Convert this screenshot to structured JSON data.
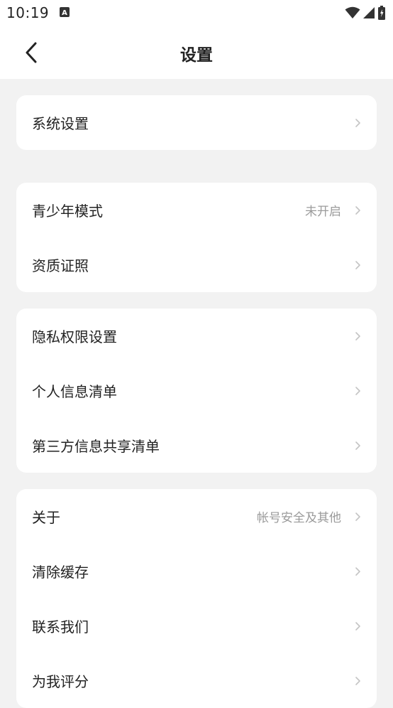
{
  "status_bar": {
    "time": "10:19",
    "app_icon": "A",
    "icons": [
      "wifi-icon",
      "signal-icon",
      "battery-icon"
    ]
  },
  "header": {
    "title": "设置",
    "back_icon": "back-arrow-icon"
  },
  "sections": [
    {
      "items": [
        {
          "label": "系统设置"
        }
      ]
    },
    {
      "items": [
        {
          "label": "青少年模式",
          "value": "未开启"
        },
        {
          "label": "资质证照"
        }
      ]
    },
    {
      "items": [
        {
          "label": "隐私权限设置"
        },
        {
          "label": "个人信息清单"
        },
        {
          "label": "第三方信息共享清单"
        }
      ]
    },
    {
      "items": [
        {
          "label": "关于",
          "value": "帐号安全及其他"
        },
        {
          "label": "清除缓存"
        },
        {
          "label": "联系我们"
        },
        {
          "label": "为我评分"
        }
      ]
    }
  ],
  "colors": {
    "background": "#f2f2f2",
    "card": "#ffffff",
    "text": "#222222",
    "secondary_text": "#9b9b9b",
    "chevron": "#c4c4c4"
  }
}
